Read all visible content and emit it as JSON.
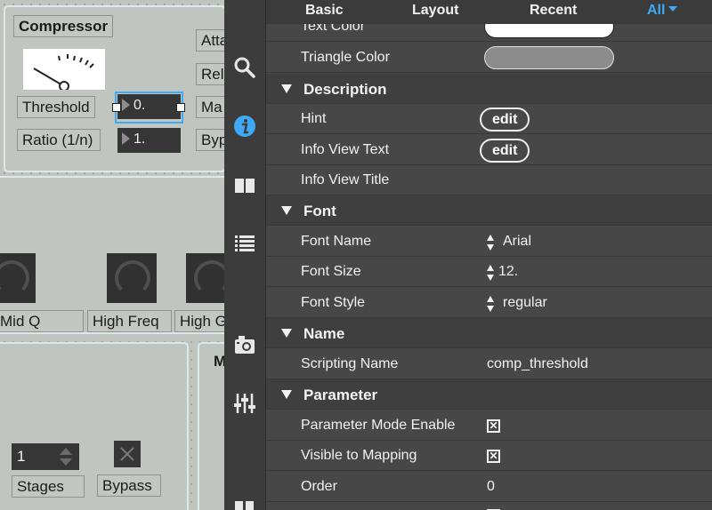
{
  "patcher": {
    "compressor_title": "Compressor",
    "threshold_label": "Threshold",
    "ratio_label": "Ratio (1/n)",
    "threshold_value": "0.",
    "ratio_value": "1.",
    "attack_label": "Atta",
    "release_label": "Rel",
    "makeup_label": "Ma",
    "bypass_short_label": "Byp",
    "mid_q_label": "Mid Q",
    "high_freq_label": "High Freq",
    "high_gain_label": "High G",
    "stages_value": "1",
    "stages_label": "Stages",
    "bypass_label": "Bypass",
    "partial_panel_label": "M"
  },
  "tabs": {
    "basic": "Basic",
    "layout": "Layout",
    "recent": "Recent",
    "all": "All"
  },
  "sidebar": {
    "icons": [
      "search-icon",
      "info-icon",
      "book-icon",
      "list-icon",
      "camera-icon",
      "sliders-icon"
    ]
  },
  "inspector": {
    "text_color_label": "Text Color",
    "triangle_color_label": "Triangle Color",
    "description_header": "Description",
    "hint_label": "Hint",
    "hint_button": "edit",
    "info_view_text_label": "Info View Text",
    "info_view_text_button": "edit",
    "info_view_title_label": "Info View Title",
    "font_header": "Font",
    "font_name_label": "Font Name",
    "font_name_value": "Arial",
    "font_size_label": "Font Size",
    "font_size_value": "12.",
    "font_style_label": "Font Style",
    "font_style_value": "regular",
    "name_header": "Name",
    "scripting_name_label": "Scripting Name",
    "scripting_name_value": "comp_threshold",
    "parameter_header": "Parameter",
    "parameter_mode_label": "Parameter Mode Enable",
    "parameter_mode_checked": true,
    "visible_mapping_label": "Visible to Mapping",
    "visible_mapping_checked": true,
    "order_label": "Order",
    "order_value": "0"
  },
  "colors": {
    "accent": "#3fa9f5",
    "text_color_swatch": "#ffffff",
    "triangle_color_swatch": "#8c8c8c",
    "selection": "#3fa9f5"
  }
}
